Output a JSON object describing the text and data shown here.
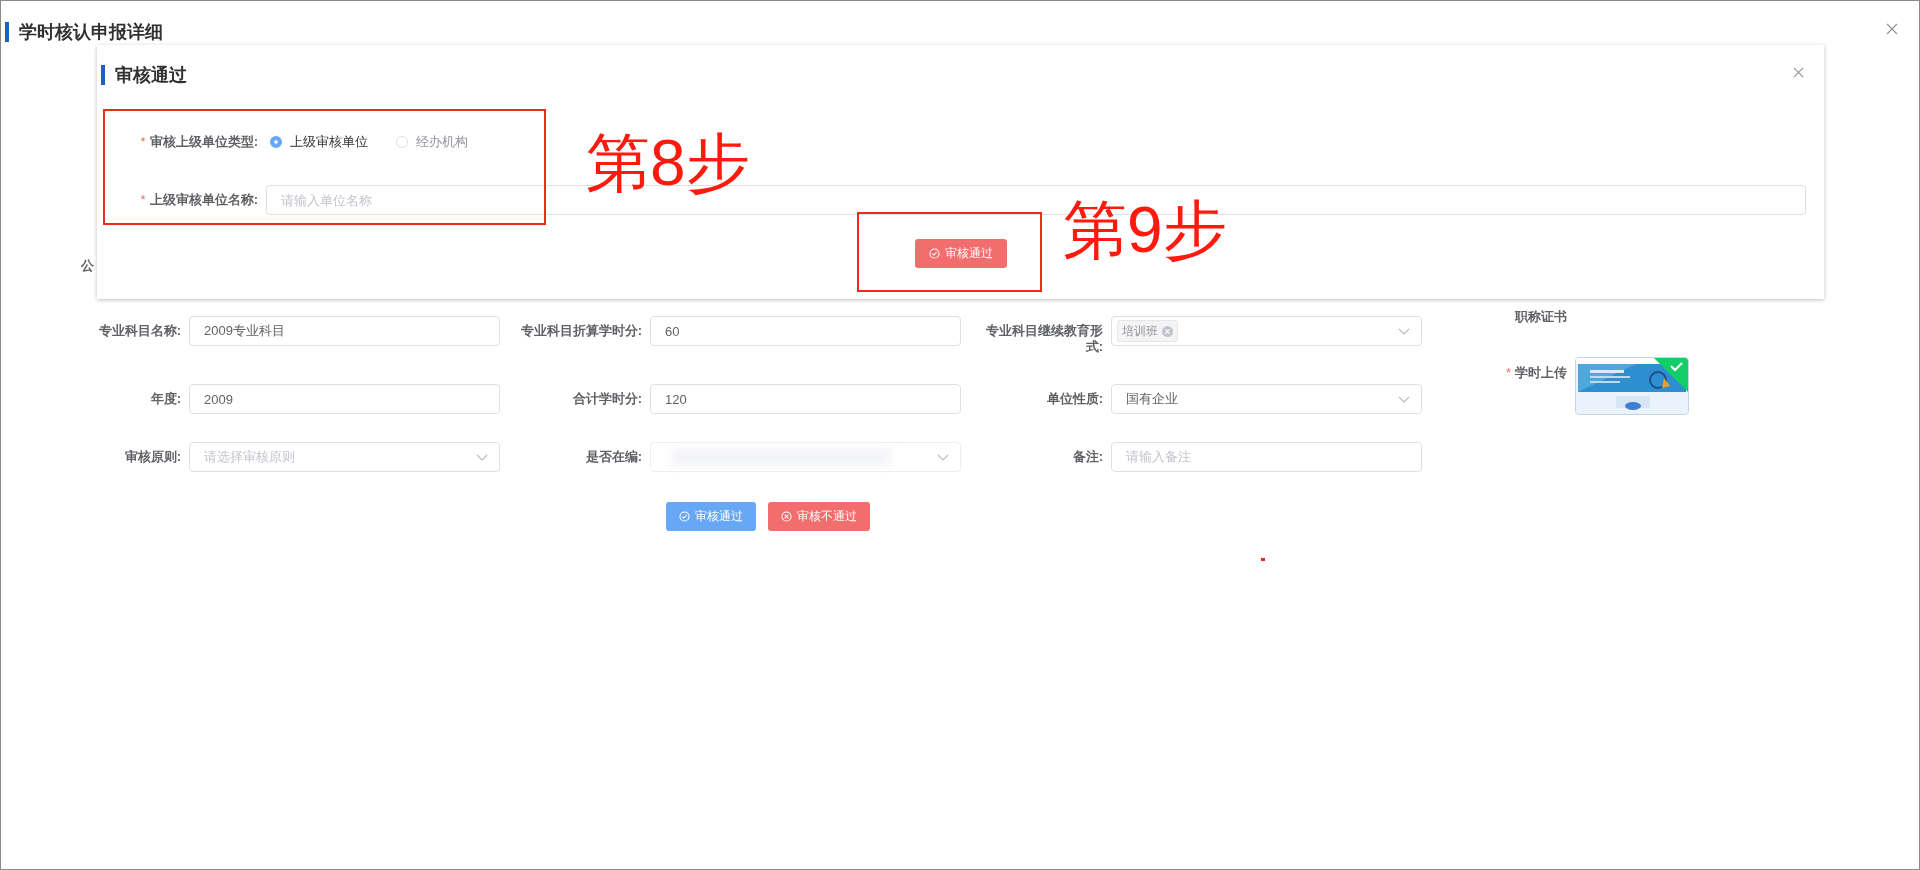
{
  "page": {
    "title": "学时核认申报详细"
  },
  "dialog": {
    "title": "审核通过",
    "fields": [
      {
        "kind": "radio",
        "label": "审核上级单位类型:",
        "required_mark": "*",
        "options": [
          {
            "label": "上级审核单位",
            "selected": true
          },
          {
            "label": "经办机构",
            "selected": false
          }
        ]
      },
      {
        "kind": "input",
        "label": "上级审核单位名称:",
        "required_mark": "*",
        "placeholder": "请输入单位名称"
      }
    ],
    "button": "审核通过"
  },
  "hidden_label_fragment": "公",
  "form": {
    "rows": [
      [
        {
          "kind": "input",
          "label": "专业科目名称:",
          "value": "2009专业科目"
        },
        {
          "kind": "input",
          "label": "专业科目折算学时分:",
          "value": "60"
        },
        {
          "kind": "tags",
          "label": "专业科目继续教育形式:",
          "tags": [
            "培训班"
          ]
        }
      ],
      [
        {
          "kind": "input",
          "label": "年度:",
          "value": "2009"
        },
        {
          "kind": "input",
          "label": "合计学时分:",
          "value": "120"
        },
        {
          "kind": "select",
          "label": "单位性质:",
          "value": "国有企业"
        }
      ],
      [
        {
          "kind": "select",
          "label": "审核原则:",
          "placeholder": "请选择审核原则"
        },
        {
          "kind": "select",
          "label": "是否在编:",
          "blurred": true
        },
        {
          "kind": "input",
          "label": "备注:",
          "placeholder": "请输入备注"
        }
      ]
    ],
    "side": [
      {
        "kind": "label",
        "label": "职称证书"
      },
      {
        "kind": "upload",
        "label": "学时上传",
        "required_mark": "*",
        "uploaded": true
      }
    ],
    "actions": [
      {
        "label": "审核通过",
        "kind": "primary"
      },
      {
        "label": "审核不通过",
        "kind": "danger"
      }
    ]
  },
  "annotations": [
    {
      "text": "第8步"
    },
    {
      "text": "第9步"
    }
  ]
}
